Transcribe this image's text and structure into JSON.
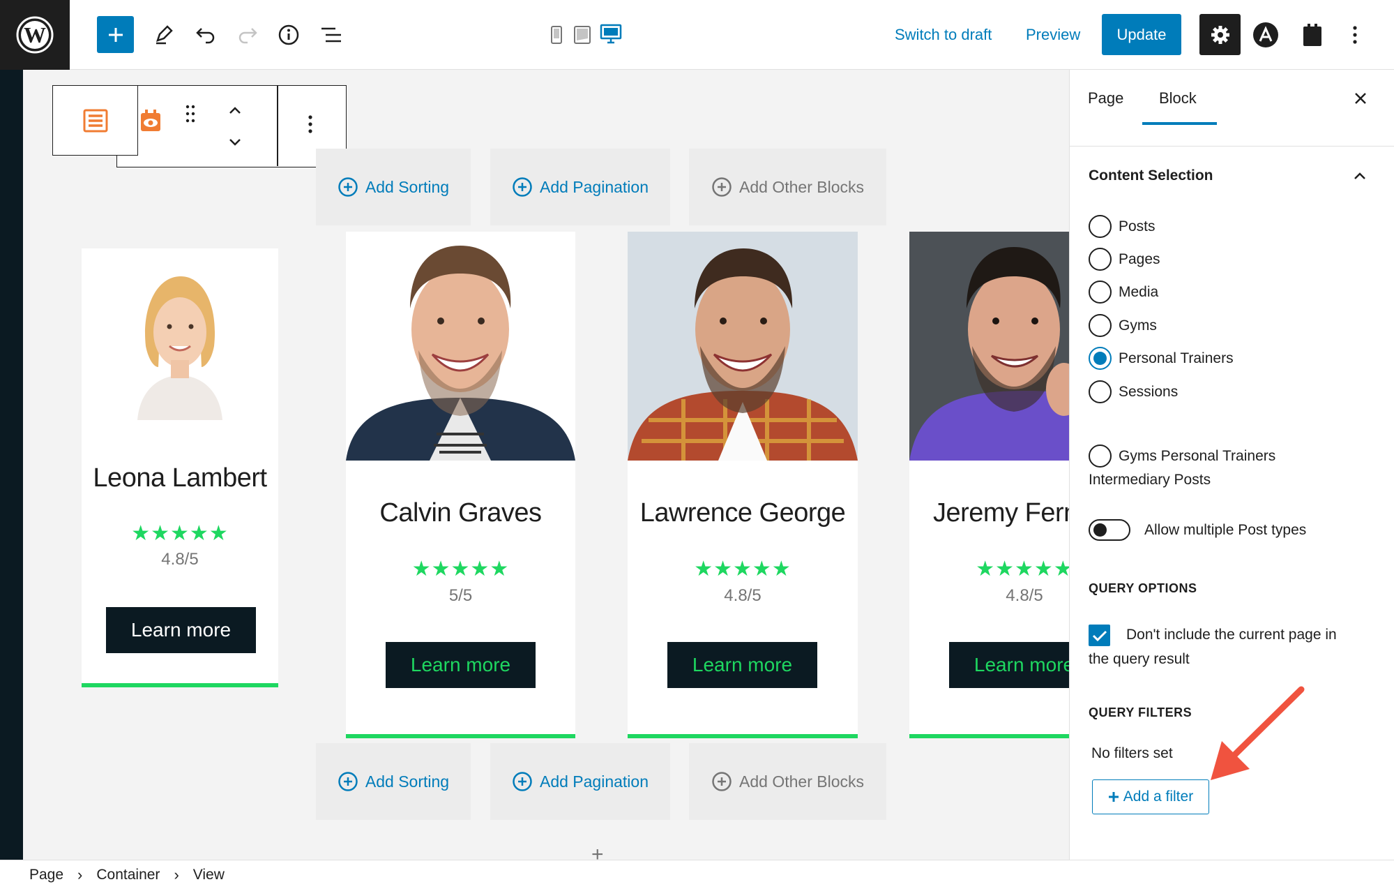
{
  "toolbar": {
    "switch_to_draft": "Switch to draft",
    "preview": "Preview",
    "update": "Update"
  },
  "add_rows": [
    {
      "sorting": "Add Sorting",
      "pagination": "Add Pagination",
      "other": "Add Other Blocks"
    },
    {
      "sorting": "Add Sorting",
      "pagination": "Add Pagination",
      "other": "Add Other Blocks"
    }
  ],
  "cards": [
    {
      "name": "Leona Lambert",
      "stars": "★★★★★",
      "rating": "4.8/5",
      "button": "Learn more"
    },
    {
      "name": "Calvin Graves",
      "stars": "★★★★★",
      "rating": "5/5",
      "button": "Learn more"
    },
    {
      "name": "Lawrence George",
      "stars": "★★★★★",
      "rating": "4.8/5",
      "button": "Learn more"
    },
    {
      "name": "Jeremy Ferna",
      "stars": "★★★★★",
      "rating": "4.8/5",
      "button": "Learn more"
    }
  ],
  "colors": {
    "accent": "#007cba",
    "star_green": "#1ed760",
    "button_dark": "#0b1a22",
    "arrow_red": "#f0533f"
  },
  "sidebar": {
    "tabs": [
      "Page",
      "Block"
    ],
    "content_selection": "Content Selection",
    "post_types": [
      "Posts",
      "Pages",
      "Media",
      "Gyms",
      "Personal Trainers",
      "Sessions"
    ],
    "intermediary_line1": "Gyms Personal Trainers",
    "intermediary_line2": "Intermediary Posts",
    "selected": "Personal Trainers",
    "allow_multiple": "Allow multiple Post types",
    "query_options": "QUERY OPTIONS",
    "exclude_line1": "Don't include the current page in",
    "exclude_line2": "the query result",
    "query_filters": "QUERY FILTERS",
    "no_filters": "No filters set",
    "add_filter": "Add a filter"
  },
  "breadcrumb": [
    "Page",
    "Container",
    "View"
  ]
}
